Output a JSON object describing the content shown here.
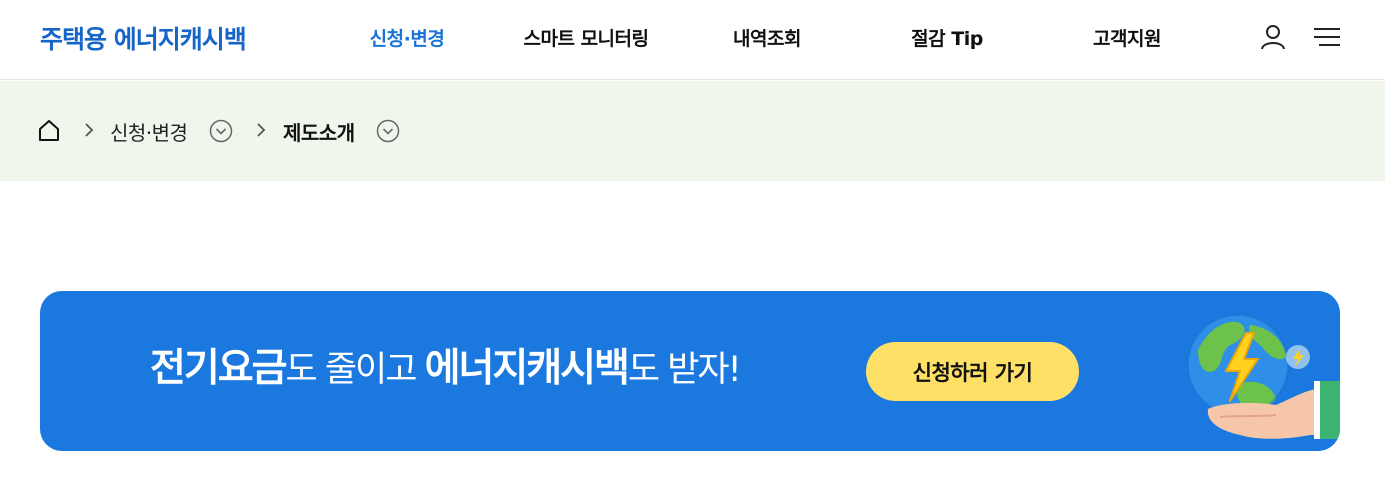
{
  "header": {
    "logo": "주택용 에너지캐시백",
    "nav": [
      "신청·변경",
      "스마트 모니터링",
      "내역조회",
      "절감 Tip",
      "고객지원"
    ],
    "active_index": 0,
    "accent_color": "#1a73d9",
    "icons": [
      "user-icon",
      "menu-icon"
    ]
  },
  "breadcrumb": {
    "home_icon": "home-icon",
    "items": [
      "신청·변경",
      "제도소개"
    ]
  },
  "banner": {
    "strong1": "전기요금",
    "light1": "도 줄이고 ",
    "strong2": "에너지캐시백",
    "light2": "도 받자!",
    "button_label": "신청하러 가기",
    "illustration": "globe-in-hand-illustration",
    "background_color": "#1a78df",
    "button_color": "#ffe066"
  }
}
